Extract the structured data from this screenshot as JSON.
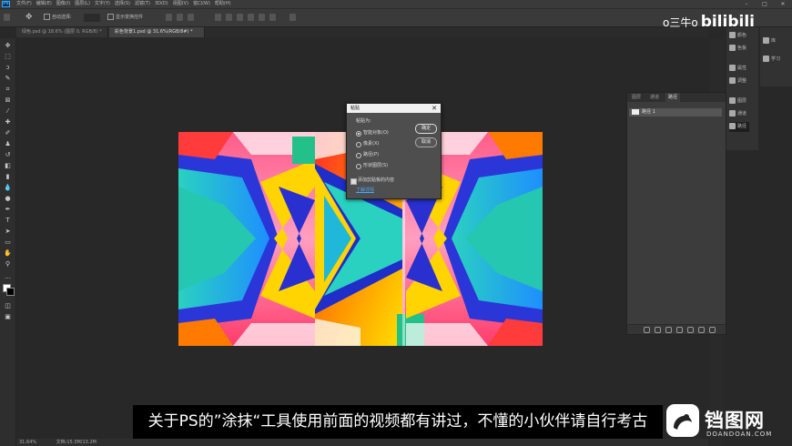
{
  "app": {
    "logo": "Ps",
    "menu": [
      "文件(F)",
      "编辑(E)",
      "图像(I)",
      "图层(L)",
      "文字(Y)",
      "选择(S)",
      "滤镜(T)",
      "3D(D)",
      "视图(V)",
      "窗口(W)",
      "帮助(H)"
    ]
  },
  "options": {
    "auto_select_label": "自动选择:",
    "show_transform_label": "显示变换控件"
  },
  "tabs": [
    {
      "label": "绿色.psd @ 18.6% (图层 0, RGB/8) *"
    },
    {
      "label": "彩色背景1.psd @ 31.6%(RGB/8#) *"
    }
  ],
  "dock": {
    "items": [
      "颜色",
      "色板",
      "属性",
      "调整",
      "图层",
      "通道",
      "路径"
    ],
    "items2": [
      "库",
      "学习"
    ]
  },
  "panel": {
    "tabs": [
      "图层",
      "通道",
      "路径"
    ],
    "path_item": "路径 1"
  },
  "dialog": {
    "title": "粘贴",
    "paste_as": "粘贴为:",
    "options": [
      "智能对象(O)",
      "像素(X)",
      "路径(P)",
      "形状图层(S)"
    ],
    "selected_index": 0,
    "ok": "确定",
    "cancel": "取消",
    "checkbox_label": "添加剪贴板的内容",
    "link": "了解详情"
  },
  "subtitle": "关于PS的”涂抹“工具使用前面的视频都有讲过，不懂的小伙伴请自行考古",
  "status": {
    "zoom": "31.64%",
    "doc": "文档:15.3M/13.2M"
  },
  "watermark": {
    "user": "o三牛o",
    "brand": "bilibili",
    "logo_cn": "铛图网",
    "logo_en": "DOANDOAN.COM"
  }
}
